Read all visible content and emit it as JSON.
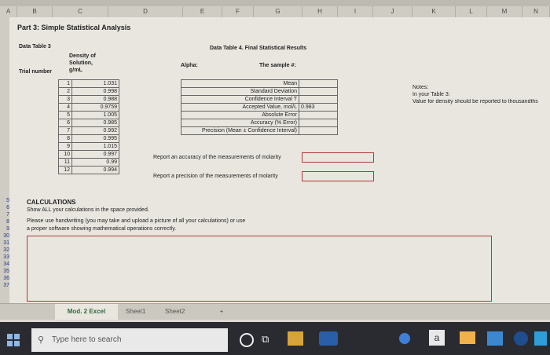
{
  "columns": [
    "A",
    "B",
    "C",
    "D",
    "E",
    "F",
    "G",
    "H",
    "I",
    "J",
    "K",
    "L",
    "M",
    "N"
  ],
  "rows": [
    "5",
    "6",
    "7",
    "8",
    "9",
    "30",
    "31",
    "32",
    "33",
    "34",
    "35",
    "36",
    "37"
  ],
  "title": "Part 3: Simple Statistical Analysis",
  "data_table3": {
    "title": "Data Table 3",
    "col_trial": "Trial number",
    "col_density": [
      "Density of",
      "Solution,",
      "g/mL"
    ],
    "trials": [
      "1",
      "2",
      "3",
      "4",
      "5",
      "6",
      "7",
      "8",
      "9",
      "10",
      "11",
      "12"
    ],
    "densities": [
      "1.031",
      "0.998",
      "0.988",
      "0.9759",
      "1.005",
      "0.985",
      "0.992",
      "0.995",
      "1.015",
      "0.997",
      "0.99",
      "0.994"
    ]
  },
  "alpha_label": "Alpha:",
  "data_table4": {
    "title": "Data Table 4. Final Statistical Results",
    "sample_label": "The sample #:",
    "rows": [
      "Mean",
      "Standard Deviation",
      "Confidence Interval T",
      "Accepted Value, mol/L",
      "Absolute Error",
      "Accuracy (% Error)",
      "Precision (Mean ± Confidence Interval)"
    ],
    "accepted_value": "0.983"
  },
  "notes": {
    "label": "Notes:",
    "line1": "In your Table 3:",
    "line2": "Value for density should be reported to thousandths"
  },
  "report_accuracy": "Report an accuracy of the measurements of molarity",
  "report_precision": "Report a precision of the measurements of molarity",
  "calculations": {
    "heading": "CALCULATIONS",
    "line1": "Show ALL your calculations in the space provided.",
    "line2": "Please use handwriting (you may take and upload a picture of all your calculations) or use",
    "line3": "a proper software showing mathematical operations correctly."
  },
  "sheet_tabs": {
    "active": "Mod. 2 Excel",
    "tab2": "Sheet1",
    "tab3": "Sheet2",
    "add": "+"
  },
  "taskbar": {
    "search_placeholder": "Type here to search"
  },
  "colors": {
    "accent_red": "#b03a3a",
    "taskbar": "#2a2b31"
  }
}
